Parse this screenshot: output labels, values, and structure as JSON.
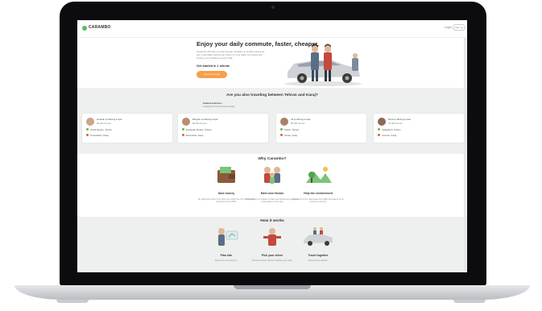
{
  "nav": {
    "brand": "CARAMBO",
    "login": "Login",
    "signup": "Sign up"
  },
  "hero": {
    "title": "Enjoy your daily commute, faster, cheaper.",
    "subtitle": "Carambo will help you find people travelling to similar places as you, potentially saving you hours on your daily commutes and cutting your travelling cost by half.",
    "cta_label": "Get started in 1 minute",
    "cta_button": "Find your route"
  },
  "routes": {
    "title": "Are you also traveling between Tehran and Karaj?",
    "featured": "Featured drivers",
    "featured_sub": "Looking for ride Tehran to Karaj",
    "cards": [
      {
        "who": "Hossein is offering a seat",
        "price": "90,000 Toman",
        "from": "Azadi Square, Tehran",
        "to": "Gohardasht, Karaj"
      },
      {
        "who": "Maryam is offering a seat",
        "price": "85,000 Toman",
        "from": "Enghelab Square, Tehran",
        "to": "Mehrshahr, Karaj"
      },
      {
        "who": "Ali is offering a seat",
        "price": "80,000 Toman",
        "from": "Tajrish, Tehran",
        "to": "Fardis, Karaj"
      },
      {
        "who": "Reza is offering a seat",
        "price": "75,000 Toman",
        "from": "Sadeghieh, Tehran",
        "to": "Azimieh, Karaj"
      }
    ]
  },
  "why": {
    "title": "Why Carambo?",
    "features": [
      {
        "title": "Save money",
        "desc": "By sharing the cost of your drive you reduce the cost of your daily commute by up to 50%."
      },
      {
        "title": "Meet new friends",
        "desc": "Sharing rides is a chance to make new friends and enjoy good conversation on your way."
      },
      {
        "title": "Help the environment",
        "desc": "Fewer cars on the road means less traffic and cleaner air for everyone in the city."
      }
    ]
  },
  "how": {
    "title": "How it works",
    "steps": [
      {
        "title": "Plan ride",
        "desc": "Enter your route and time."
      },
      {
        "title": "Pick your driver",
        "desc": "Choose the driver that best matches your route."
      },
      {
        "title": "Travel together",
        "desc": "Enjoy the ride together."
      }
    ]
  },
  "colors": {
    "accent": "#f5a04a",
    "brand": "#5dbb63",
    "section_bg": "#eef0ef"
  }
}
